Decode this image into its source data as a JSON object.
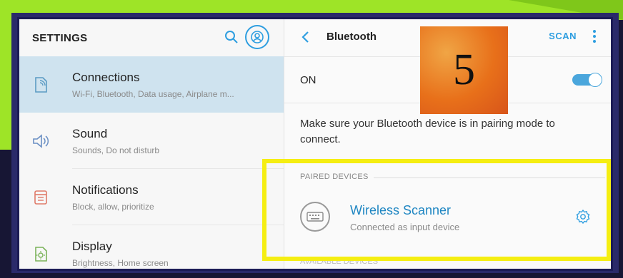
{
  "colors": {
    "accent": "#2e9ee0",
    "highlight": "#f5ee12",
    "active_bg": "#cfe3ef"
  },
  "left": {
    "title": "SETTINGS",
    "items": [
      {
        "label": "Connections",
        "sub": "Wi-Fi, Bluetooth, Data usage, Airplane m...",
        "icon": "connections-icon",
        "active": true
      },
      {
        "label": "Sound",
        "sub": "Sounds, Do not disturb",
        "icon": "sound-icon"
      },
      {
        "label": "Notifications",
        "sub": "Block, allow, prioritize",
        "icon": "notifications-icon"
      },
      {
        "label": "Display",
        "sub": "Brightness, Home screen",
        "icon": "display-icon"
      }
    ]
  },
  "right": {
    "title": "Bluetooth",
    "scan_label": "SCAN",
    "on_label": "ON",
    "toggle_on": true,
    "hint": "Make sure your Bluetooth device is in pairing mode to connect.",
    "paired_header": "PAIRED DEVICES",
    "device": {
      "name": "Wireless Scanner",
      "status": "Connected as input device",
      "icon": "keyboard-icon"
    },
    "available_header": "AVAILABLE DEVICES"
  },
  "step_badge": "5"
}
